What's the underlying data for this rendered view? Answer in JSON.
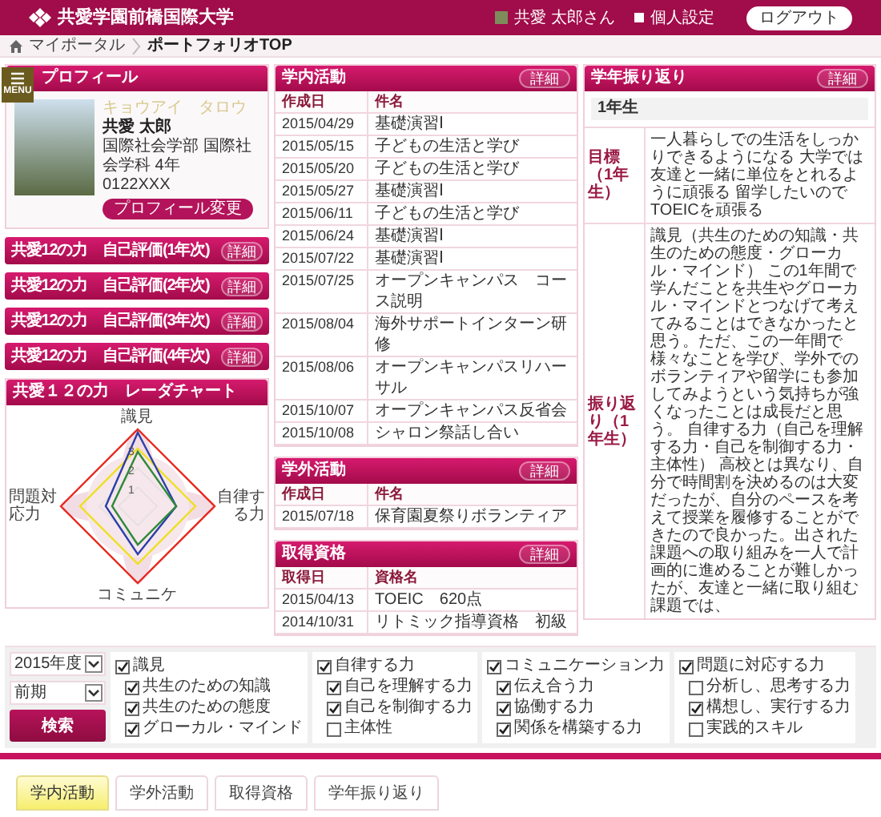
{
  "header": {
    "university": "共愛学園前橋国際大学",
    "user": "共愛 太郎さん",
    "settings": "個人設定",
    "logout": "ログアウト"
  },
  "breadcrumb": [
    {
      "label": "マイポータル"
    },
    {
      "label": "ポートフォリオTOP"
    }
  ],
  "menu_label": "MENU",
  "profile": {
    "title": "プロフィール",
    "kana": "キョウアイ　タロウ",
    "name": "共愛 太郎",
    "department": "国際社会学部 国際社会学科 4年",
    "student_id": "0122XXX",
    "edit_button": "プロフィール変更"
  },
  "self_evaluations": [
    {
      "title": "共愛12の力　自己評価(1年次)",
      "detail": "詳細"
    },
    {
      "title": "共愛12の力　自己評価(2年次)",
      "detail": "詳細"
    },
    {
      "title": "共愛12の力　自己評価(3年次)",
      "detail": "詳細"
    },
    {
      "title": "共愛12の力　自己評価(4年次)",
      "detail": "詳細"
    }
  ],
  "radar": {
    "title": "共愛１２の力　レーダチャート",
    "axes": [
      "識見",
      "自律する力",
      "コミュニケ",
      "問題対応力"
    ],
    "ticks": [
      "3",
      "2",
      "1"
    ]
  },
  "activity_panels": [
    {
      "title": "学内活動",
      "detail": "詳細",
      "columns": [
        "作成日",
        "件名"
      ],
      "rows": [
        [
          "2015/04/29",
          "基礎演習Ⅰ"
        ],
        [
          "2015/05/15",
          "子どもの生活と学び"
        ],
        [
          "2015/05/20",
          "子どもの生活と学び"
        ],
        [
          "2015/05/27",
          "基礎演習Ⅰ"
        ],
        [
          "2015/06/11",
          "子どもの生活と学び"
        ],
        [
          "2015/06/24",
          "基礎演習Ⅰ"
        ],
        [
          "2015/07/22",
          "基礎演習Ⅰ"
        ],
        [
          "2015/07/25",
          "オープンキャンパス　コース説明"
        ],
        [
          "2015/08/04",
          "海外サポートインターン研修"
        ],
        [
          "2015/08/06",
          "オープンキャンパスリハーサル"
        ],
        [
          "2015/10/07",
          "オープンキャンパス反省会"
        ],
        [
          "2015/10/08",
          "シャロン祭話し合い"
        ]
      ]
    },
    {
      "title": "学外活動",
      "detail": "詳細",
      "columns": [
        "作成日",
        "件名"
      ],
      "rows": [
        [
          "2015/07/18",
          "保育園夏祭りボランティア"
        ]
      ]
    },
    {
      "title": "取得資格",
      "detail": "詳細",
      "columns": [
        "取得日",
        "資格名"
      ],
      "rows": [
        [
          "2015/04/13",
          "TOEIC　620点"
        ],
        [
          "2014/10/31",
          "リトミック指導資格　初級"
        ]
      ]
    }
  ],
  "reflection": {
    "title": "学年振り返り",
    "detail": "詳細",
    "year": "1年生",
    "rows": [
      {
        "label": "目標（1年生）",
        "text": "一人暮らしでの生活をしっかりできるようになる 大学では友達と一緒に単位をとれるように頑張る 留学したいのでTOEICを頑張る"
      },
      {
        "label": "振り返り（1年生）",
        "text": "識見（共生のための知識・共生のための態度・グローカル・マインド） この1年間で学んだことを共生やグローカル・マインドとつなげて考えてみることはできなかったと思う。ただ、この一年間で様々なことを学び、学外でのボランティアや留学にも参加してみようという気持ちが強くなったことは成長だと思う。 自律する力（自己を理解する力・自己を制御する力・主体性） 高校とは異なり、自分で時間割を決めるのは大変だったが、自分のペースを考えて授業を履修することができたので良かった。出された課題への取り組みを一人で計画的に進めることが難しかったが、友達と一緒に取り組む課題では、"
      }
    ]
  },
  "filter": {
    "year": "2015年度",
    "term": "前期",
    "search_button": "検索",
    "groups": [
      {
        "label": "識見",
        "checked": true,
        "items": [
          {
            "label": "共生のための知識",
            "checked": true
          },
          {
            "label": "共生のための態度",
            "checked": true
          },
          {
            "label": "グローカル・マインド",
            "checked": true
          }
        ]
      },
      {
        "label": "自律する力",
        "checked": true,
        "items": [
          {
            "label": "自己を理解する力",
            "checked": true
          },
          {
            "label": "自己を制御する力",
            "checked": true
          },
          {
            "label": "主体性",
            "checked": false
          }
        ]
      },
      {
        "label": "コミュニケーション力",
        "checked": true,
        "items": [
          {
            "label": "伝え合う力",
            "checked": true
          },
          {
            "label": "協働する力",
            "checked": true
          },
          {
            "label": "関係を構築する力",
            "checked": true
          }
        ]
      },
      {
        "label": "問題に対応する力",
        "checked": true,
        "items": [
          {
            "label": "分析し、思考する力",
            "checked": false
          },
          {
            "label": "構想し、実行する力",
            "checked": true
          },
          {
            "label": "実践的スキル",
            "checked": false
          }
        ]
      }
    ]
  },
  "tabs": [
    {
      "label": "学内活動",
      "selected": true
    },
    {
      "label": "学外活動",
      "selected": false
    },
    {
      "label": "取得資格",
      "selected": false
    },
    {
      "label": "学年振り返り",
      "selected": false
    }
  ]
}
